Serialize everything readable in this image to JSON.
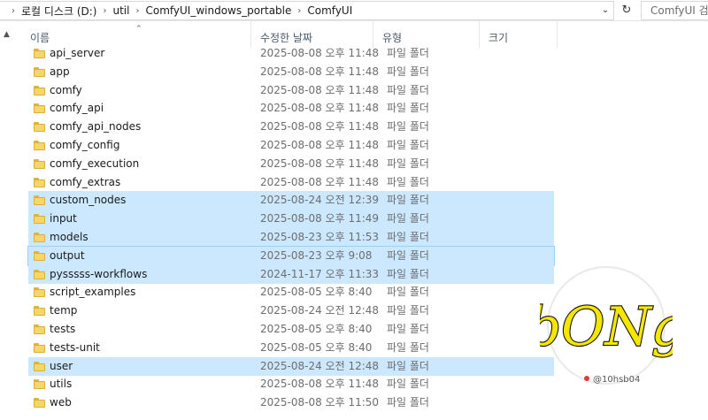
{
  "breadcrumb": [
    "로컬 디스크 (D:)",
    "util",
    "ComfyUI_windows_portable",
    "ComfyUI"
  ],
  "search": {
    "placeholder": "ComfyUI 검"
  },
  "columns": {
    "name": "이름",
    "date": "수정한 날짜",
    "type": "유형",
    "size": "크기"
  },
  "rows": [
    {
      "name": "api_server",
      "date": "2025-08-08 오후 11:48",
      "type": "파일 폴더",
      "state": "normal"
    },
    {
      "name": "app",
      "date": "2025-08-08 오후 11:48",
      "type": "파일 폴더",
      "state": "normal"
    },
    {
      "name": "comfy",
      "date": "2025-08-08 오후 11:48",
      "type": "파일 폴더",
      "state": "normal"
    },
    {
      "name": "comfy_api",
      "date": "2025-08-08 오후 11:48",
      "type": "파일 폴더",
      "state": "normal"
    },
    {
      "name": "comfy_api_nodes",
      "date": "2025-08-08 오후 11:48",
      "type": "파일 폴더",
      "state": "normal"
    },
    {
      "name": "comfy_config",
      "date": "2025-08-08 오후 11:48",
      "type": "파일 폴더",
      "state": "normal"
    },
    {
      "name": "comfy_execution",
      "date": "2025-08-08 오후 11:48",
      "type": "파일 폴더",
      "state": "normal"
    },
    {
      "name": "comfy_extras",
      "date": "2025-08-08 오후 11:48",
      "type": "파일 폴더",
      "state": "normal"
    },
    {
      "name": "custom_nodes",
      "date": "2025-08-24 오전 12:39",
      "type": "파일 폴더",
      "state": "selected"
    },
    {
      "name": "input",
      "date": "2025-08-08 오후 11:49",
      "type": "파일 폴더",
      "state": "selected"
    },
    {
      "name": "models",
      "date": "2025-08-23 오후 11:53",
      "type": "파일 폴더",
      "state": "selected"
    },
    {
      "name": "output",
      "date": "2025-08-23 오후 9:08",
      "type": "파일 폴더",
      "state": "focused"
    },
    {
      "name": "pysssss-workflows",
      "date": "2024-11-17 오후 11:33",
      "type": "파일 폴더",
      "state": "selected"
    },
    {
      "name": "script_examples",
      "date": "2025-08-05 오후 8:40",
      "type": "파일 폴더",
      "state": "normal"
    },
    {
      "name": "temp",
      "date": "2025-08-24 오전 12:48",
      "type": "파일 폴더",
      "state": "normal"
    },
    {
      "name": "tests",
      "date": "2025-08-05 오후 8:40",
      "type": "파일 폴더",
      "state": "normal"
    },
    {
      "name": "tests-unit",
      "date": "2025-08-05 오후 8:40",
      "type": "파일 폴더",
      "state": "normal"
    },
    {
      "name": "user",
      "date": "2025-08-24 오전 12:48",
      "type": "파일 폴더",
      "state": "selected"
    },
    {
      "name": "utils",
      "date": "2025-08-08 오후 11:48",
      "type": "파일 폴더",
      "state": "normal"
    },
    {
      "name": "web",
      "date": "2025-08-08 오후 11:50",
      "type": "파일 폴더",
      "state": "normal"
    }
  ],
  "watermark": {
    "logo_text": "bONg",
    "handle": "@10hsb04"
  },
  "colors": {
    "selection": "#cce8ff",
    "focus_border": "#99d1ff",
    "folder": "#f6d66b",
    "watermark_accent": "#f5e600"
  }
}
